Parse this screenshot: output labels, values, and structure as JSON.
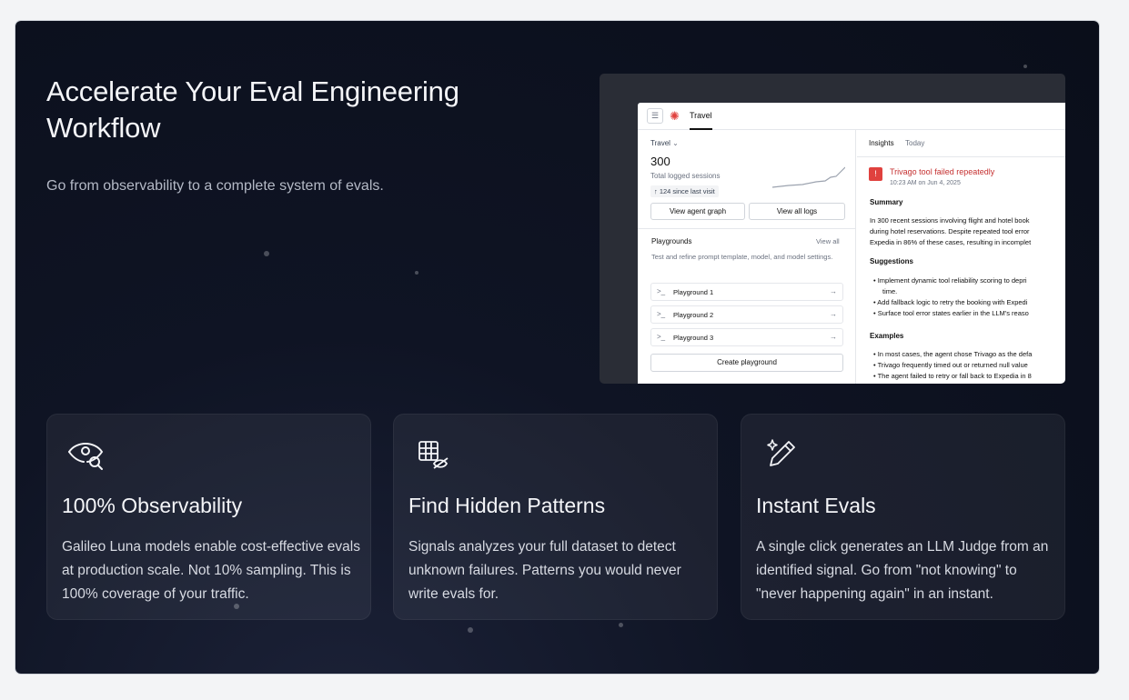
{
  "hero": {
    "headline": "Accelerate Your Eval Engineering Workflow",
    "subline": "Go from observability to a complete system of evals."
  },
  "app_preview": {
    "tab": "Travel",
    "project": {
      "name": "Travel",
      "sessions_count": "300",
      "sessions_label": "Total logged sessions",
      "delta": "↑ 124 since last visit",
      "view_graph": "View agent graph",
      "view_logs": "View all logs"
    },
    "playgrounds": {
      "title": "Playgrounds",
      "view_all": "View all",
      "desc": "Test and refine prompt template, model, and model settings.",
      "items": [
        "Playground 1",
        "Playground 2",
        "Playground 3"
      ],
      "create": "Create playground"
    },
    "insights": {
      "title": "Insights",
      "when": "Today",
      "alert_title": "Trivago tool failed repeatedly",
      "alert_time": "10:23 AM on Jun 4, 2025",
      "summary_heading": "Summary",
      "summary_line1": "In 300 recent sessions involving flight and hotel book",
      "summary_line2": "during hotel reservations. Despite repeated tool error",
      "summary_line3": "Expedia in 86% of these cases, resulting in incomplet",
      "suggestions_heading": "Suggestions",
      "suggestion1a": "Implement dynamic tool reliability scoring to depri",
      "suggestion1b": "time.",
      "suggestion2": "Add fallback logic to retry the booking with Expedi",
      "suggestion3": "Surface tool error states earlier in the LLM's reaso",
      "examples_heading": "Examples",
      "example1": "In most cases, the agent chose Trivago as the defa",
      "example2": "Trivago frequently timed out or returned null value",
      "example3": "The agent failed to retry or fall back to Expedia in 8"
    }
  },
  "features": [
    {
      "icon": "eye-search-icon",
      "title": "100% Observability",
      "body": "Galileo Luna models enable cost-effective evals at production scale. Not 10% sampling. This is 100% coverage of your traffic."
    },
    {
      "icon": "grid-hidden-icon",
      "title": "Find Hidden Patterns",
      "body": "Signals analyzes your full dataset to detect unknown failures. Patterns you would never write evals for."
    },
    {
      "icon": "sparkle-pen-icon",
      "title": "Instant Evals",
      "body": "A single click generates an LLM Judge from an identified signal. Go from \"not knowing\" to \"never happening again\" in an instant."
    }
  ],
  "colors": {
    "accent_red": "#e0413e",
    "panel_bg": "#0f1424"
  }
}
